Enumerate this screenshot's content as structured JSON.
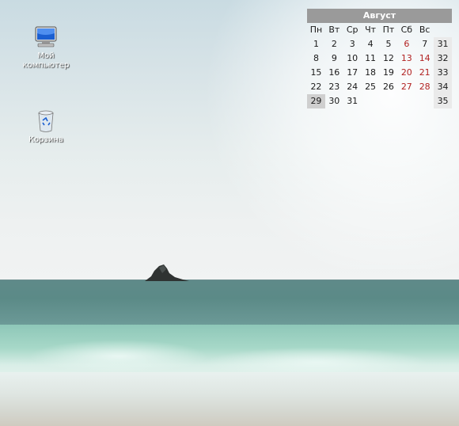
{
  "desktop": {
    "icons": [
      {
        "label": "Мой компьютер",
        "icon": "my-computer-icon"
      },
      {
        "label": "Корзина",
        "icon": "recycle-bin-icon"
      }
    ]
  },
  "calendar": {
    "month": "Август",
    "weekdays": [
      "Пн",
      "Вт",
      "Ср",
      "Чт",
      "Пт",
      "Сб",
      "Вс"
    ],
    "weeks": [
      {
        "days": [
          "",
          "1",
          "2",
          "3",
          "4",
          "5",
          "6",
          "7"
        ],
        "week_no": "31"
      },
      {
        "days": [
          "8",
          "9",
          "10",
          "11",
          "12",
          "13",
          "14"
        ],
        "week_no": "32"
      },
      {
        "days": [
          "15",
          "16",
          "17",
          "18",
          "19",
          "20",
          "21"
        ],
        "week_no": "33"
      },
      {
        "days": [
          "22",
          "23",
          "24",
          "25",
          "26",
          "27",
          "28"
        ],
        "week_no": "34"
      },
      {
        "days": [
          "29",
          "30",
          "31",
          "",
          "",
          "",
          ""
        ],
        "week_no": "35"
      }
    ],
    "weekend_color": "#b22222",
    "highlighted_day": "29"
  }
}
